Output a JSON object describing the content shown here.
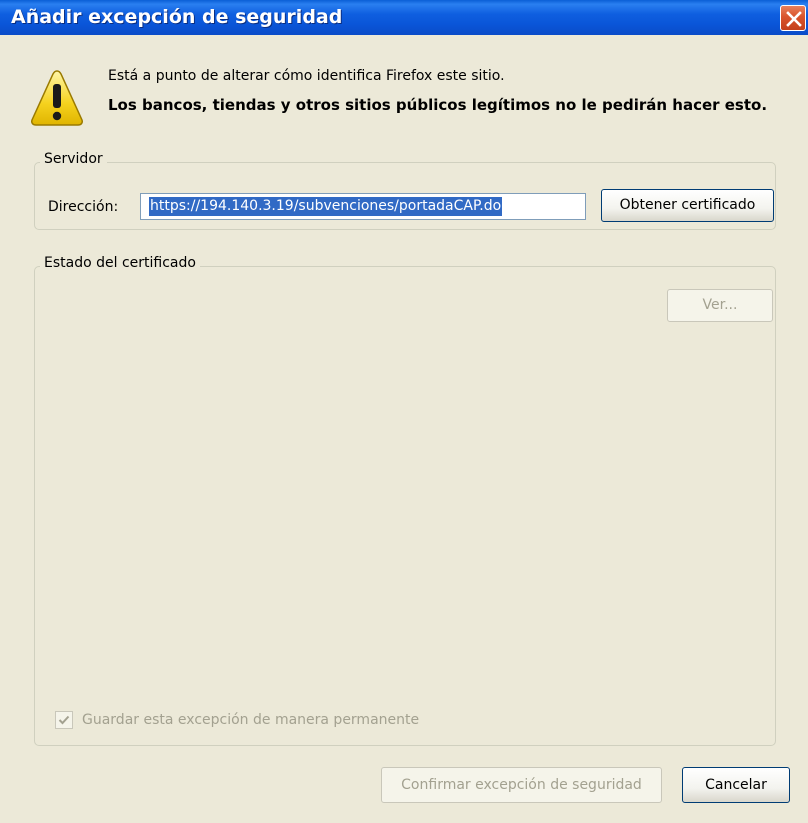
{
  "window": {
    "title": "Añadir excepción de seguridad",
    "close_icon": "close-icon"
  },
  "message": {
    "icon": "warning-icon",
    "line1": "Está a punto de alterar cómo identifica Firefox este sitio.",
    "line2": "Los bancos, tiendas y otros sitios públicos legítimos no le pedirán hacer esto."
  },
  "server": {
    "legend": "Servidor",
    "address_label": "Dirección:",
    "address_value": "https://194.140.3.19/subvenciones/portadaCAP.do",
    "get_certificate_label": "Obtener certificado"
  },
  "certificate_status": {
    "legend": "Estado del certificado",
    "view_label": "Ver...",
    "view_enabled": false
  },
  "permanent": {
    "label": "Guardar esta excepción de manera permanente",
    "checked": true,
    "enabled": false
  },
  "buttons": {
    "confirm_label": "Confirmar excepción de seguridad",
    "confirm_enabled": false,
    "cancel_label": "Cancelar"
  },
  "colors": {
    "titlebar": "#0a55d8",
    "dialog_bg": "#ece9d8",
    "close_button": "#d9542c",
    "selection": "#316ac5",
    "disabled_text": "#a3a190"
  }
}
